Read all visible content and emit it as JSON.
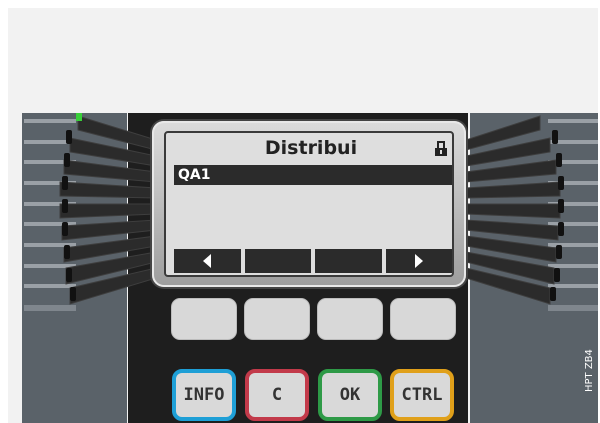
{
  "lcd": {
    "title": "Distribui",
    "selected_item": "QA1",
    "lock_icon": "lock-icon"
  },
  "softkeys": [
    {
      "icon": "arrow-left-icon"
    },
    {
      "icon": ""
    },
    {
      "icon": ""
    },
    {
      "icon": "arrow-right-icon"
    }
  ],
  "function_keys": {
    "info": "INFO",
    "c": "C",
    "ok": "OK",
    "ctrl": "CTRL"
  },
  "colors": {
    "info": "#1e9fd6",
    "c": "#c23a4a",
    "ok": "#2e9a47",
    "ctrl": "#e0a01a",
    "led": "#39d03a"
  },
  "side_code": "HPT ZB4"
}
